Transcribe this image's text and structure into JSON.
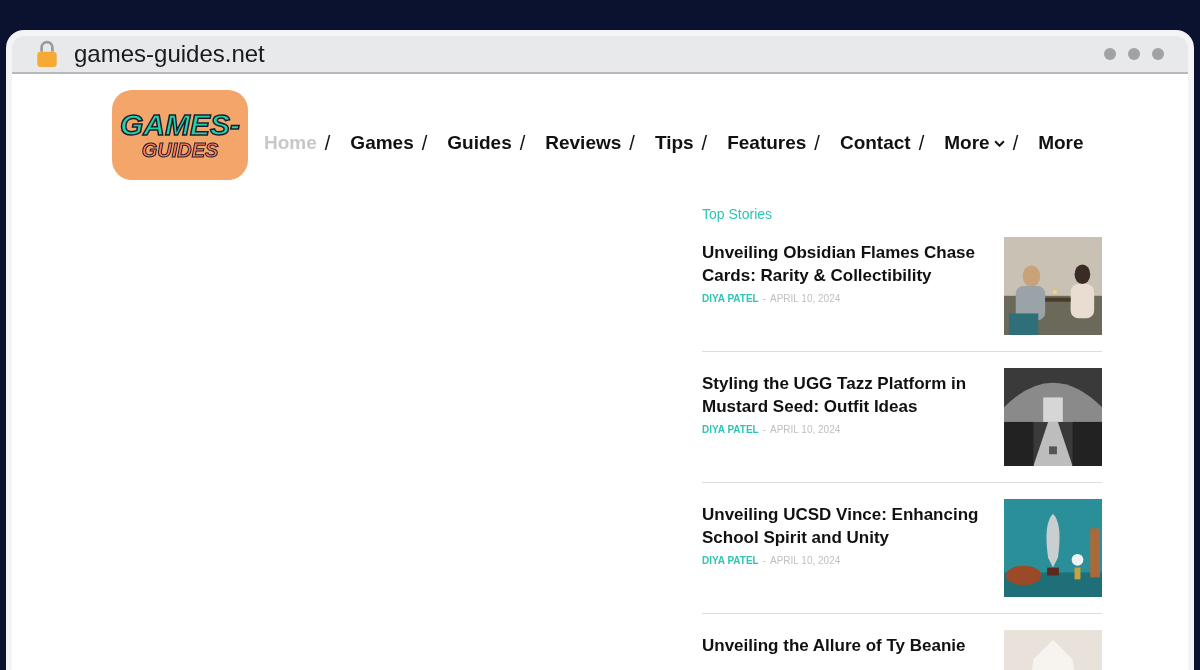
{
  "browser": {
    "url": "games-guides.net"
  },
  "logo": {
    "line1": "GAMES-",
    "line2": "GUIDES"
  },
  "nav": [
    {
      "label": "Home",
      "selected": true,
      "separator": "/"
    },
    {
      "label": "Games",
      "selected": false,
      "separator": "/"
    },
    {
      "label": "Guides",
      "selected": false,
      "separator": "/"
    },
    {
      "label": "Reviews",
      "selected": false,
      "separator": "/"
    },
    {
      "label": "Tips",
      "selected": false,
      "separator": "/"
    },
    {
      "label": "Features",
      "selected": false,
      "separator": "/"
    },
    {
      "label": "Contact",
      "selected": false,
      "separator": "/"
    },
    {
      "label": "More",
      "selected": false,
      "dropdown": true,
      "separator": "/"
    },
    {
      "label": "More",
      "selected": false
    }
  ],
  "top_stories": {
    "heading": "Top Stories",
    "stories": [
      {
        "title": "Unveiling Obsidian Flames Chase Cards: Rarity & Collectibility",
        "author": "DIYA PATEL",
        "separator": "-",
        "date": "APRIL 10, 2024"
      },
      {
        "title": "Styling the UGG Tazz Platform in Mustard Seed: Outfit Ideas",
        "author": "DIYA PATEL",
        "separator": "-",
        "date": "APRIL 10, 2024"
      },
      {
        "title": "Unveiling UCSD Vince: Enhancing School Spirit and Unity",
        "author": "DIYA PATEL",
        "separator": "-",
        "date": "APRIL 10, 2024"
      },
      {
        "title": "Unveiling the Allure of Ty Beanie"
      }
    ]
  }
}
